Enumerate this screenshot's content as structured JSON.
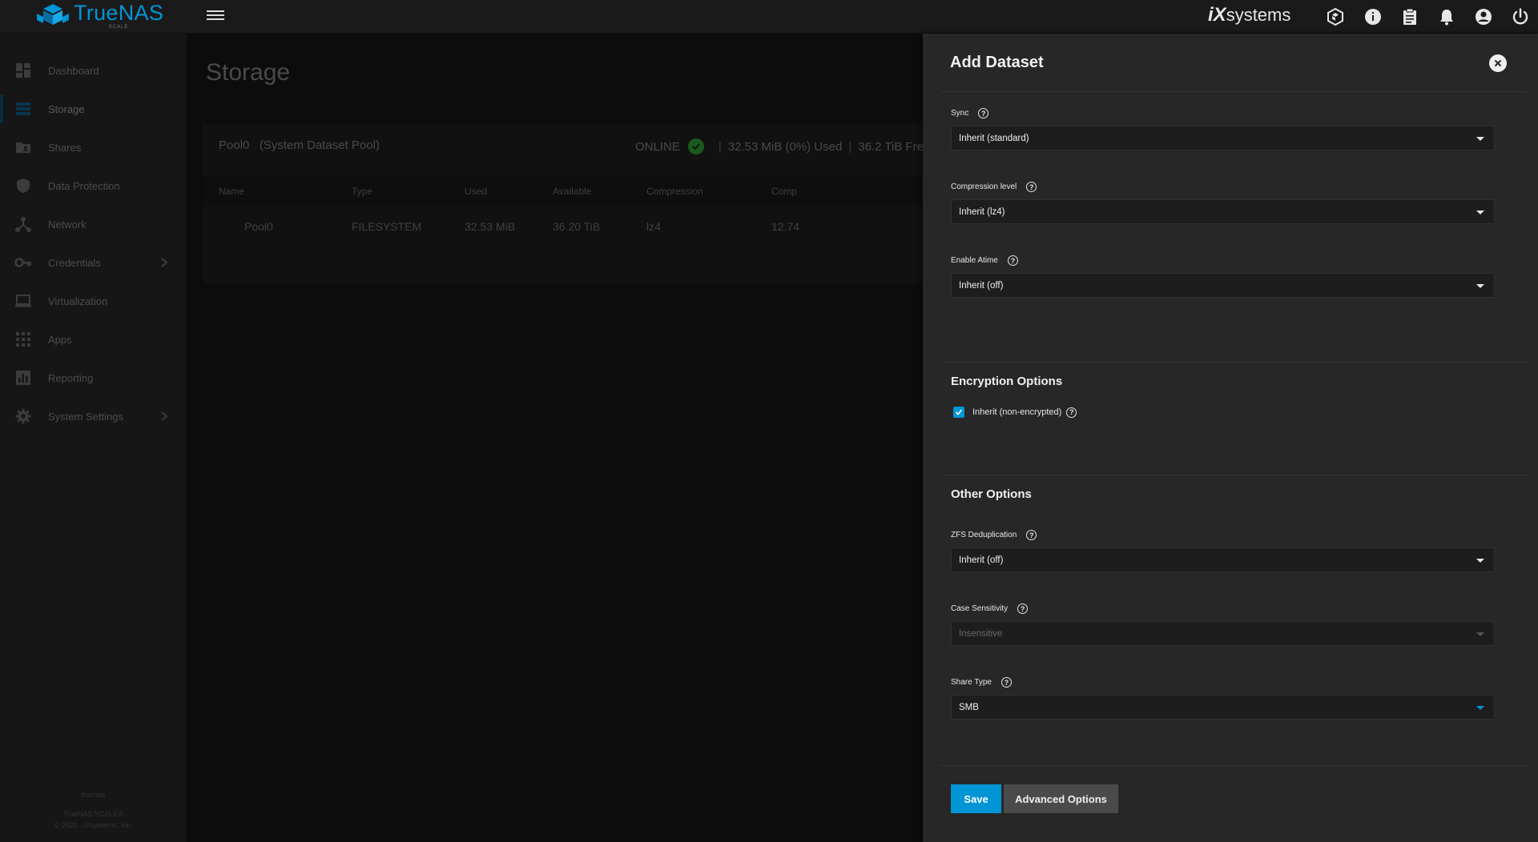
{
  "topbar": {
    "logo_name": "TrueNAS",
    "logo_sub": "SCALE",
    "brand_ix": "iX",
    "brand_systems": "systems",
    "icons": [
      "truecommand-icon",
      "info-icon",
      "clipboard-icon",
      "bell-icon",
      "account-icon",
      "power-icon"
    ]
  },
  "sidebar": {
    "items": [
      {
        "label": "Dashboard",
        "icon": "dashboard-icon"
      },
      {
        "label": "Storage",
        "icon": "storage-icon"
      },
      {
        "label": "Shares",
        "icon": "shares-icon"
      },
      {
        "label": "Data Protection",
        "icon": "shield-icon"
      },
      {
        "label": "Network",
        "icon": "network-icon"
      },
      {
        "label": "Credentials",
        "icon": "key-icon"
      },
      {
        "label": "Virtualization",
        "icon": "laptop-icon"
      },
      {
        "label": "Apps",
        "icon": "apps-grid-icon"
      },
      {
        "label": "Reporting",
        "icon": "chart-icon"
      },
      {
        "label": "System Settings",
        "icon": "gear-icon"
      }
    ],
    "footer_host": "truenas",
    "footer_product": "TrueNAS SCALE®",
    "footer_copyright": "© 2022 - iXsystems, Inc."
  },
  "main": {
    "title": "Storage",
    "pool": {
      "name": "Pool0",
      "subtitle": "(System Dataset Pool)",
      "status": "ONLINE",
      "used": "32.53 MiB (0%) Used",
      "free": "36.2 TiB Free"
    },
    "table": {
      "headers": [
        "Name",
        "Type",
        "Used",
        "Available",
        "Compression",
        "Comp"
      ],
      "rows": [
        [
          "Pool0",
          "FILESYSTEM",
          "32.53 MiB",
          "36.20 TiB",
          "lz4",
          "12.74"
        ]
      ]
    }
  },
  "panel": {
    "title": "Add Dataset",
    "sync": {
      "label": "Sync",
      "value": "Inherit (standard)"
    },
    "compression": {
      "label": "Compression level",
      "value": "Inherit (lz4)"
    },
    "atime": {
      "label": "Enable Atime",
      "value": "Inherit (off)"
    },
    "encryption_title": "Encryption Options",
    "encryption_inherit": {
      "label": "Inherit (non-encrypted)",
      "checked": true
    },
    "other_title": "Other Options",
    "dedup": {
      "label": "ZFS Deduplication",
      "value": "Inherit (off)"
    },
    "case": {
      "label": "Case Sensitivity",
      "value": "Insensitive"
    },
    "share_type": {
      "label": "Share Type",
      "value": "SMB"
    },
    "save_label": "Save",
    "advanced_label": "Advanced Options",
    "help_glyph": "?"
  },
  "colors": {
    "accent": "#0095d5",
    "panel_bg": "#272727",
    "topbar_bg": "#1a1a1a"
  }
}
